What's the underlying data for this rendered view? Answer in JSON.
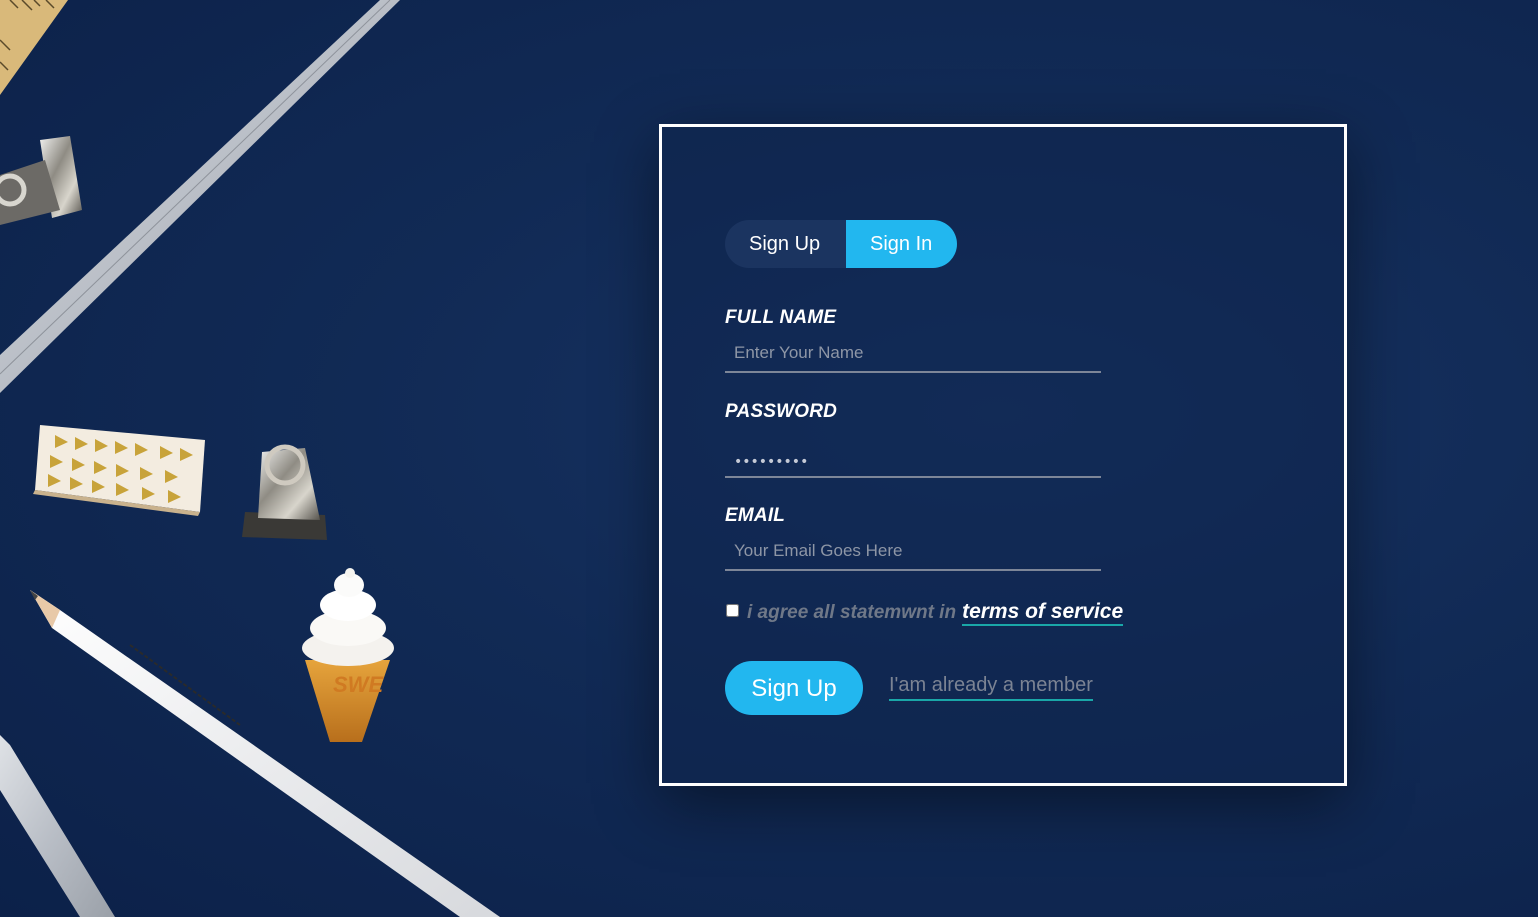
{
  "tabs": {
    "sign_up": "Sign Up",
    "sign_in": "Sign In",
    "active": "Sign In"
  },
  "fields": {
    "full_name": {
      "label": "FULL NAME",
      "placeholder": "Enter Your Name",
      "value": ""
    },
    "password": {
      "label": "PASSWORD",
      "masked_value": "•••••••••"
    },
    "email": {
      "label": "EMAIL",
      "placeholder": "Your Email Goes Here",
      "value": ""
    }
  },
  "agreement": {
    "text": "i agree all statemwnt in",
    "link_text": "terms of service",
    "checked": false
  },
  "actions": {
    "submit_label": "Sign Up",
    "member_link": "I'am already a member"
  },
  "colors": {
    "background": "#112a55",
    "accent": "#22b7ef",
    "tab_inactive": "#1b3460",
    "link_underline": "#1aa7a8",
    "card_border": "#ffffff"
  }
}
